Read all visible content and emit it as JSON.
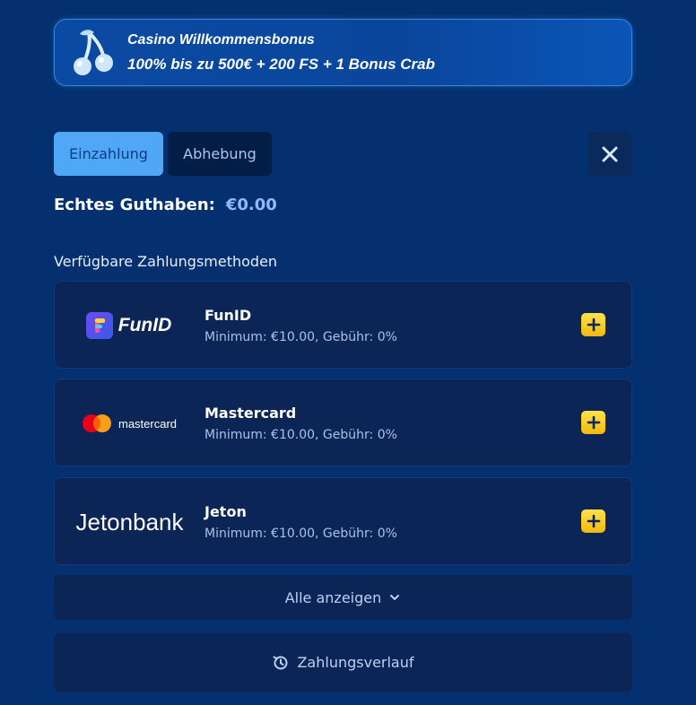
{
  "banner": {
    "line1": "Casino Willkommensbonus",
    "line2": "100% bis zu 500€ + 200 FS + 1 Bonus Crab",
    "icon": "cherry-icon"
  },
  "tabs": [
    {
      "label": "Einzahlung",
      "active": true
    },
    {
      "label": "Abhebung",
      "active": false
    }
  ],
  "balance": {
    "label": "Echtes Guthaben:",
    "amount": "€0.00"
  },
  "methods_title": "Verfügbare Zahlungsmethoden",
  "methods": [
    {
      "name": "FunID",
      "info": "Minimum: €10.00, Gebühr: 0%",
      "logo_text": "FunID"
    },
    {
      "name": "Mastercard",
      "info": "Minimum: €10.00, Gebühr: 0%",
      "logo_text": "mastercard"
    },
    {
      "name": "Jeton",
      "info": "Minimum: €10.00, Gebühr: 0%",
      "logo_text": "Jetonbank"
    }
  ],
  "show_all": "Alle anzeigen",
  "history": "Zahlungsverlauf",
  "colors": {
    "background": "#04306f",
    "accent": "#4fa7f6",
    "add_button": "#f2c01a",
    "card": "#0b2656"
  }
}
